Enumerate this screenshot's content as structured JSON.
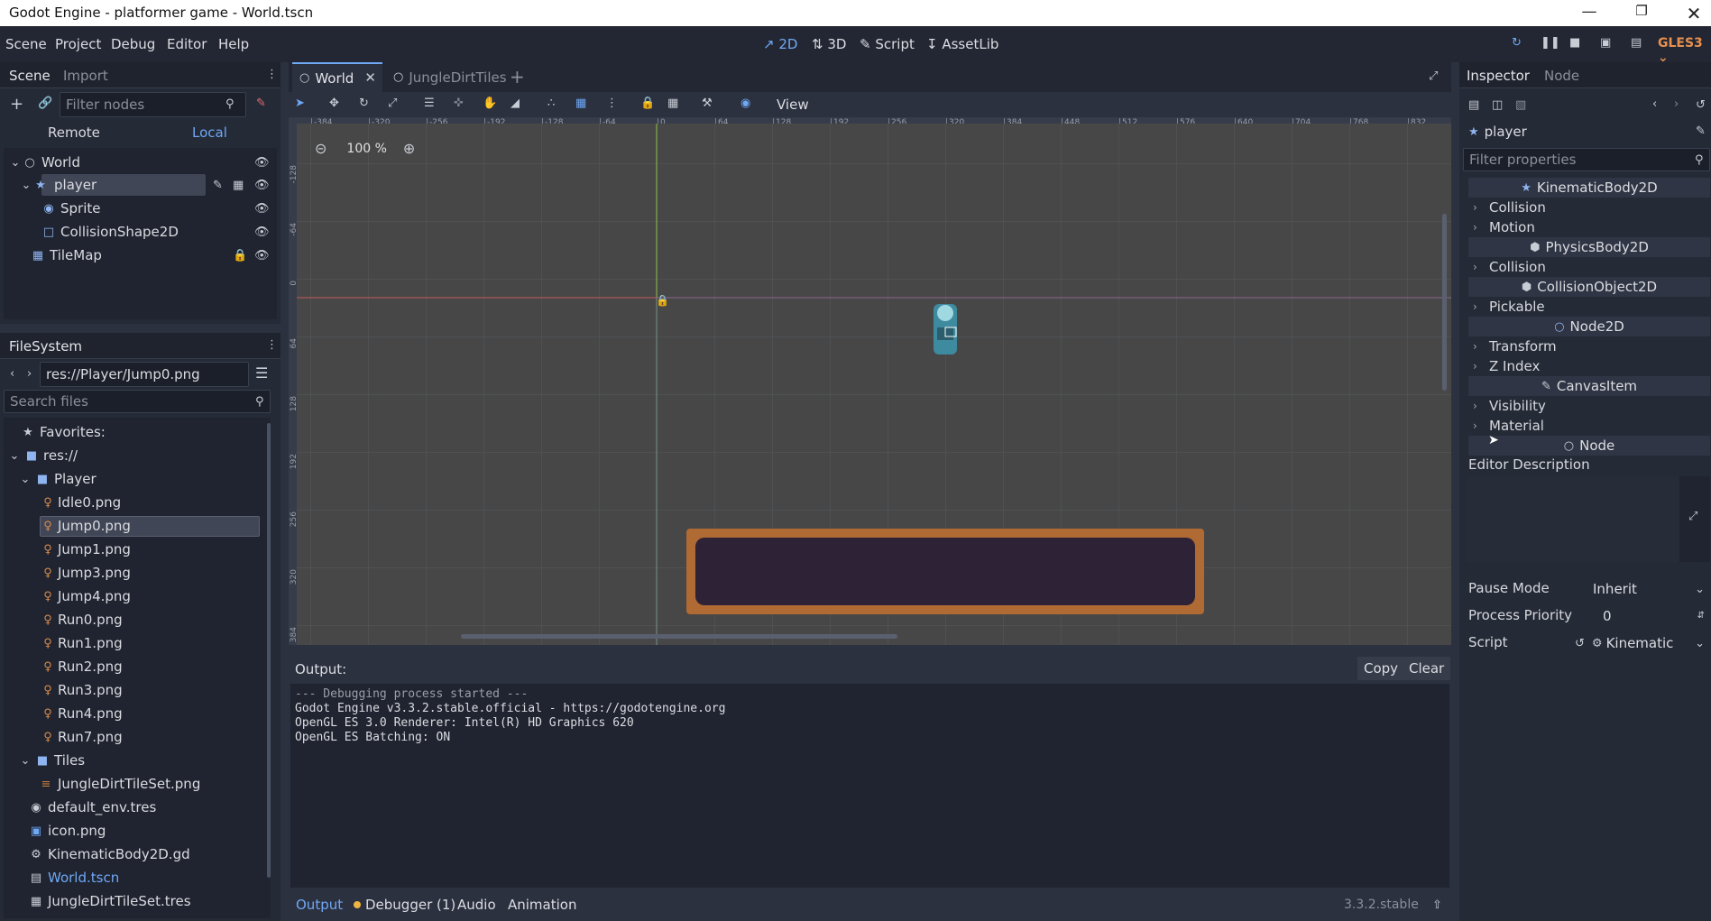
{
  "window": {
    "title": "Godot Engine - platformer game - World.tscn"
  },
  "menu": {
    "items": [
      "Scene",
      "Project",
      "Debug",
      "Editor",
      "Help"
    ]
  },
  "modes": {
    "m2d": "2D",
    "m3d": "3D",
    "script": "Script",
    "assetlib": "AssetLib"
  },
  "renderer": "GLES3",
  "scene_dock": {
    "tabs": [
      "Scene",
      "Import"
    ],
    "filter_placeholder": "Filter nodes",
    "remote": "Remote",
    "local": "Local",
    "tree": {
      "world": "World",
      "player": "player",
      "sprite": "Sprite",
      "collision": "CollisionShape2D",
      "tilemap": "TileMap"
    }
  },
  "filesystem": {
    "tab": "FileSystem",
    "path": "res://Player/Jump0.png",
    "search_placeholder": "Search files",
    "favorites": "Favorites:",
    "root": "res://",
    "player_folder": "Player",
    "player_files": [
      "Idle0.png",
      "Jump0.png",
      "Jump1.png",
      "Jump3.png",
      "Jump4.png",
      "Run0.png",
      "Run1.png",
      "Run2.png",
      "Run3.png",
      "Run4.png",
      "Run7.png"
    ],
    "tiles_folder": "Tiles",
    "tiles_file": "JungleDirtTileSet.png",
    "root_files": [
      "default_env.tres",
      "icon.png",
      "KinematicBody2D.gd",
      "World.tscn",
      "JungleDirtTileSet.tres"
    ]
  },
  "editor_tabs": {
    "world": "World",
    "jungle": "JungleDirtTiles"
  },
  "toolbar": {
    "view": "View"
  },
  "viewport": {
    "zoom": "100 %",
    "ruler_x": [
      "-384",
      "-320",
      "-256",
      "-192",
      "-128",
      "-64",
      "0",
      "64",
      "128",
      "192",
      "256",
      "320",
      "384",
      "448",
      "512",
      "576",
      "640",
      "704",
      "768",
      "832"
    ],
    "ruler_y": [
      "-128",
      "-64",
      "0",
      "64",
      "128",
      "192",
      "256",
      "320",
      "384"
    ]
  },
  "output": {
    "label": "Output:",
    "copy": "Copy",
    "clear": "Clear",
    "lines": [
      "--- Debugging process started ---",
      "Godot Engine v3.3.2.stable.official - https://godotengine.org",
      "OpenGL ES 3.0 Renderer: Intel(R) HD Graphics 620",
      "OpenGL ES Batching: ON"
    ]
  },
  "bottom_tabs": {
    "output": "Output",
    "debugger": "Debugger (1)",
    "audio": "Audio",
    "animation": "Animation",
    "version": "3.3.2.stable"
  },
  "inspector": {
    "tabs": [
      "Inspector",
      "Node"
    ],
    "node_name": "player",
    "filter_placeholder": "Filter properties",
    "sections": {
      "kinematic": "KinematicBody2D",
      "collision1": "Collision",
      "motion": "Motion",
      "physics": "PhysicsBody2D",
      "collision2": "Collision",
      "collobj": "CollisionObject2D",
      "pickable": "Pickable",
      "node2d": "Node2D",
      "transform": "Transform",
      "zindex": "Z Index",
      "canvas": "CanvasItem",
      "visibility": "Visibility",
      "material": "Material",
      "node": "Node"
    },
    "editor_description": "Editor Description",
    "pause_mode_label": "Pause Mode",
    "pause_mode_value": "Inherit",
    "priority_label": "Process Priority",
    "priority_value": "0",
    "script_label": "Script",
    "script_value": "Kinematic"
  },
  "colors": {
    "accent": "#6fa8f5",
    "selection": "#404656",
    "background": "#242a36"
  }
}
